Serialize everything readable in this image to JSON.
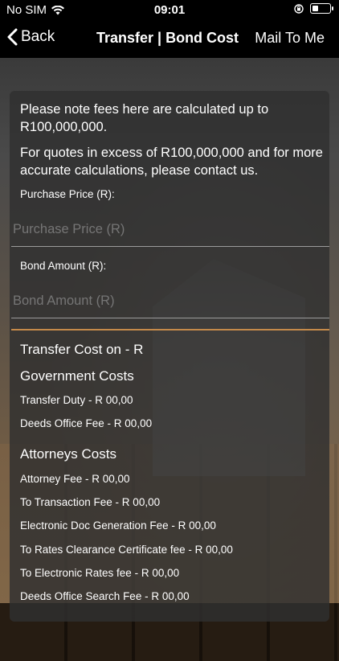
{
  "status_bar": {
    "carrier": "No SIM",
    "time": "09:01"
  },
  "nav": {
    "back_label": "Back",
    "title": "Transfer | Bond Cost",
    "mail_label": "Mail To Me"
  },
  "notes": {
    "line1": "Please note fees here are calculated up to R100,000,000.",
    "line2": "For quotes in excess of R100,000,000 and for more accurate calculations, please contact us."
  },
  "fields": {
    "purchase_label": "Purchase Price (R):",
    "purchase_placeholder": "Purchase Price (R)",
    "bond_label": "Bond Amount (R):",
    "bond_placeholder": "Bond Amount (R)"
  },
  "results": {
    "transfer_cost": "Transfer Cost on - R",
    "government_heading": "Government Costs",
    "transfer_duty": "Transfer Duty - R 00,00",
    "deeds_office_fee": "Deeds Office Fee - R 00,00",
    "attorneys_heading": "Attorneys Costs",
    "attorney_fee": "Attorney Fee - R 00,00",
    "transaction_fee": "To Transaction Fee - R 00,00",
    "electronic_doc_fee": "Electronic Doc Generation Fee - R 00,00",
    "rates_clearance_fee": "To Rates Clearance Certificate fee - R 00,00",
    "electronic_rates_fee": "To Electronic Rates fee - R 00,00",
    "deeds_search_fee": "Deeds Office Search Fee - R 00,00"
  }
}
